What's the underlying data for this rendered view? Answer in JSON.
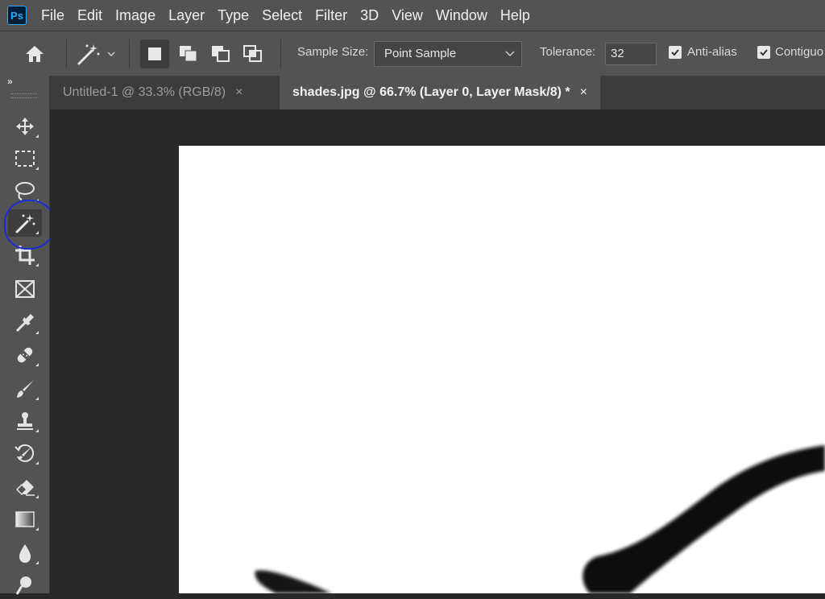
{
  "app": {
    "logo": "Ps"
  },
  "menu": [
    "File",
    "Edit",
    "Image",
    "Layer",
    "Type",
    "Select",
    "Filter",
    "3D",
    "View",
    "Window",
    "Help"
  ],
  "options": {
    "sample_size_label": "Sample Size:",
    "sample_size_value": "Point Sample",
    "tolerance_label": "Tolerance:",
    "tolerance_value": "32",
    "antialias_label": "Anti-alias",
    "antialias_checked": true,
    "contiguous_label": "Contiguo",
    "contiguous_checked": true
  },
  "toolbar": {
    "collapse_glyph": "»",
    "tools": [
      "move-tool",
      "rectangular-marquee-tool",
      "lasso-tool",
      "magic-wand-tool",
      "crop-tool",
      "frame-tool",
      "eyedropper-tool",
      "spot-healing-brush-tool",
      "brush-tool",
      "clone-stamp-tool",
      "history-brush-tool",
      "eraser-tool",
      "gradient-tool",
      "blur-tool",
      "dodge-tool"
    ],
    "active_tool": "magic-wand-tool"
  },
  "tabs": [
    {
      "label": "Untitled-1 @ 33.3% (RGB/8)",
      "close": "×",
      "active": false
    },
    {
      "label": "shades.jpg @ 66.7% (Layer 0, Layer Mask/8) *",
      "close": "×",
      "active": true
    }
  ],
  "colors": {
    "highlight_circle": "#1c2bd6",
    "ui_panel": "#535353",
    "canvas_bg": "#282828"
  }
}
